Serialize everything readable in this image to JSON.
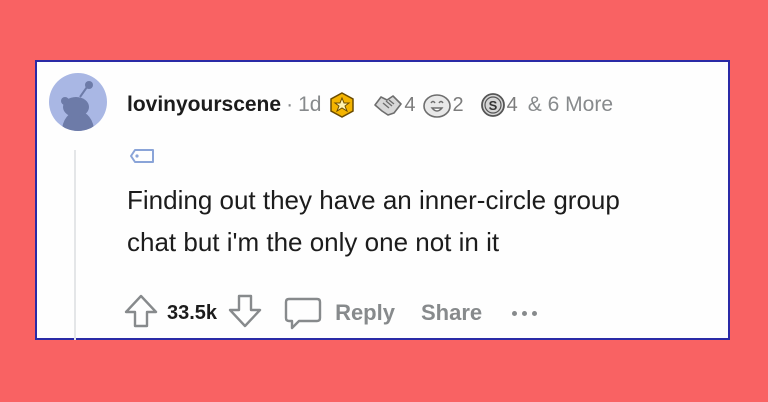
{
  "comment": {
    "username": "lovinyourscene",
    "separator": "·",
    "age": "1d",
    "awards": [
      {
        "icon": "gold-star-award-icon",
        "count": ""
      },
      {
        "icon": "handshake-award-icon",
        "count": "4"
      },
      {
        "icon": "laughing-face-award-icon",
        "count": "2"
      },
      {
        "icon": "silver-coin-award-icon",
        "count": "4"
      }
    ],
    "more_awards": "& 6 More",
    "flair_icon": "tag-icon",
    "body_lines": [
      "Finding out they have an inner-circle group",
      "chat but i'm the only one not in it"
    ]
  },
  "actions": {
    "upvote_icon": "upvote-arrow-icon",
    "score": "33.5k",
    "downvote_icon": "downvote-arrow-icon",
    "reply_icon": "speech-bubble-icon",
    "reply_label": "Reply",
    "share_label": "Share",
    "more_icon": "ellipsis-icon"
  },
  "colors": {
    "background": "#f96263",
    "card_border": "#2a2aa6",
    "text": "#1c1c1c",
    "muted": "#878a8c",
    "avatar": "#a9b7e4",
    "gold_award": "#f4b400"
  }
}
